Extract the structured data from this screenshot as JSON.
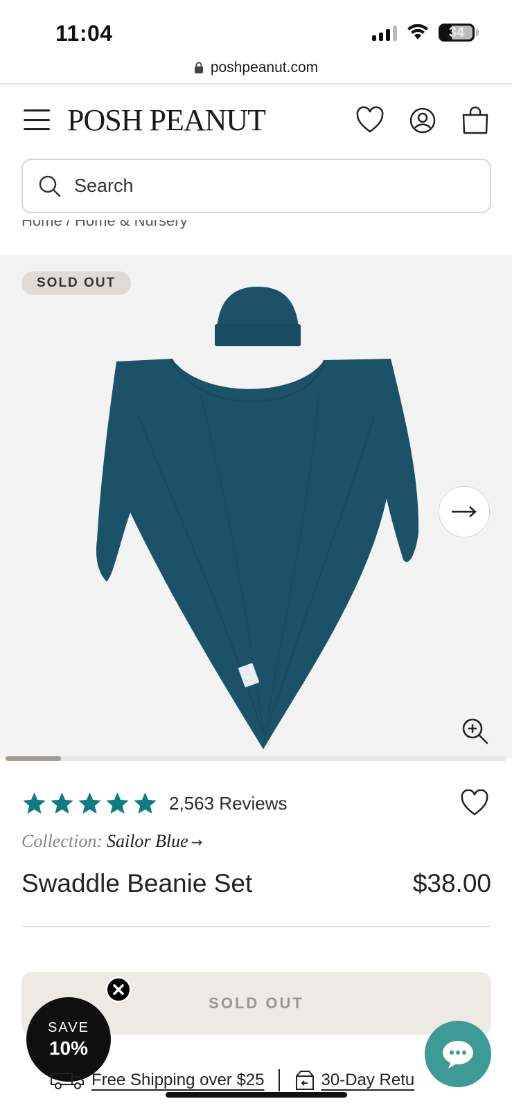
{
  "status_bar": {
    "time": "11:04",
    "battery_level": "34",
    "icons": [
      "signal-icon",
      "wifi-icon",
      "battery-icon"
    ]
  },
  "browser": {
    "url": "poshpeanut.com",
    "lock_icon": "lock-icon"
  },
  "header": {
    "logo": "POSH PEANUT",
    "icons": [
      "hamburger-menu-icon",
      "heart-icon",
      "account-icon",
      "shopping-bag-icon"
    ]
  },
  "search": {
    "placeholder": "Search"
  },
  "breadcrumb": "Home / Home & Nursery",
  "gallery": {
    "badge": "SOLD OUT",
    "image_description_icon": "swaddle-beanie-image",
    "progress": 0.11
  },
  "product": {
    "rating": 5,
    "reviews": "2,563 Reviews",
    "collection_label": "Collection:",
    "collection_name": "Sailor Blue",
    "collection_arrow": "→",
    "title": "Swaddle Beanie Set",
    "price": "$38.00",
    "button_label": "SOLD OUT"
  },
  "popup": {
    "save_label": "SAVE",
    "save_pct": "10%"
  },
  "shipping": {
    "free_shipping": "Free Shipping over $25",
    "returns": "30-Day Retu"
  },
  "colors": {
    "accent_teal": "#0f7c80",
    "product_blue": "#1c5268",
    "chat_teal": "#3e9a94",
    "badge_bg": "#dedad5"
  }
}
